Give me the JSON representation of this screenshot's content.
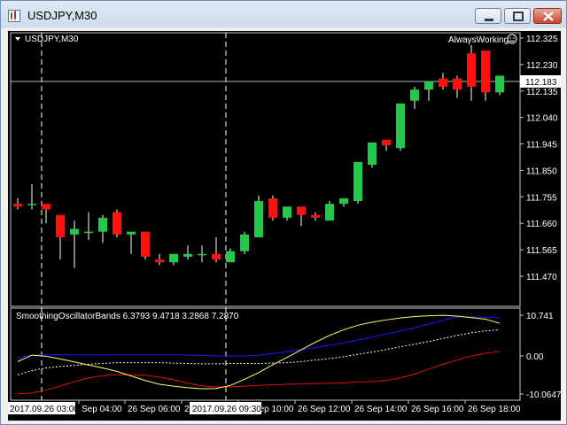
{
  "window": {
    "title": "USDJPY,M30"
  },
  "main_panel": {
    "label": "USDJPY,M30",
    "expert": "AlwaysWorking",
    "price_ticks": [
      "112.325",
      "112.230",
      "112.135",
      "112.040",
      "111.945",
      "111.850",
      "111.755",
      "111.660",
      "111.565",
      "111.470"
    ],
    "current_price": "112.183"
  },
  "indicator_panel": {
    "label": "SmoothingOscillatorBands 6.3793 9.4718 3.2868 7.2870",
    "ticks": [
      "10.741",
      "0.00",
      "-10.0647"
    ]
  },
  "time_axis": {
    "labels": [
      "Sep 04:00",
      "26 Sep 06:00",
      "26 Sep 08:00",
      "26 Sep 10:00",
      "26 Sep 12:00",
      "26 Sep 14:00",
      "26 Sep 16:00",
      "26 Sep 18:00"
    ],
    "crosshair_left": "2017.09.26 03:00",
    "crosshair_right": "2017.09.26 09:30"
  },
  "colors": {
    "bull": "#22c94a",
    "bear": "#ff1010",
    "upper_band": "#1a1aff",
    "lower_band": "#e01010",
    "oscillator": "#ffff66",
    "mid": "#ffffff"
  },
  "candles": [
    [
      111.73,
      111.75,
      111.71,
      111.72
    ],
    [
      111.73,
      111.8,
      111.71,
      111.73
    ],
    [
      111.73,
      111.73,
      111.66,
      111.71
    ],
    [
      111.69,
      111.69,
      111.53,
      111.61
    ],
    [
      111.62,
      111.67,
      111.5,
      111.64
    ],
    [
      111.63,
      111.7,
      111.6,
      111.63
    ],
    [
      111.63,
      111.69,
      111.59,
      111.68
    ],
    [
      111.7,
      111.71,
      111.61,
      111.62
    ],
    [
      111.62,
      111.63,
      111.55,
      111.63
    ],
    [
      111.63,
      111.63,
      111.53,
      111.54
    ],
    [
      111.53,
      111.55,
      111.51,
      111.52
    ],
    [
      111.52,
      111.55,
      111.51,
      111.55
    ],
    [
      111.54,
      111.58,
      111.53,
      111.55
    ],
    [
      111.55,
      111.58,
      111.52,
      111.55
    ],
    [
      111.55,
      111.61,
      111.52,
      111.53
    ],
    [
      111.52,
      111.57,
      111.52,
      111.56
    ],
    [
      111.56,
      111.63,
      111.55,
      111.62
    ],
    [
      111.61,
      111.76,
      111.61,
      111.74
    ],
    [
      111.75,
      111.76,
      111.67,
      111.68
    ],
    [
      111.68,
      111.72,
      111.67,
      111.72
    ],
    [
      111.72,
      111.72,
      111.65,
      111.69
    ],
    [
      111.69,
      111.7,
      111.67,
      111.68
    ],
    [
      111.67,
      111.74,
      111.67,
      111.73
    ],
    [
      111.73,
      111.74,
      111.72,
      111.75
    ],
    [
      111.74,
      111.88,
      111.73,
      111.88
    ],
    [
      111.87,
      111.93,
      111.86,
      111.95
    ],
    [
      111.96,
      111.96,
      111.92,
      111.94
    ],
    [
      111.93,
      112.09,
      111.92,
      112.09
    ],
    [
      112.1,
      112.15,
      112.07,
      112.14
    ],
    [
      112.14,
      112.17,
      112.1,
      112.17
    ],
    [
      112.18,
      112.2,
      112.14,
      112.15
    ],
    [
      112.18,
      112.19,
      112.11,
      112.14
    ],
    [
      112.27,
      112.3,
      112.1,
      112.15
    ],
    [
      112.28,
      112.28,
      112.1,
      112.13
    ],
    [
      112.13,
      112.19,
      112.12,
      112.19
    ]
  ],
  "indicator": {
    "range": [
      -10.0647,
      10.741
    ],
    "upper": [
      -0.5,
      0.2,
      0.3,
      0.3,
      0.3,
      0.3,
      0.3,
      0.3,
      0.3,
      0.3,
      0.3,
      0.3,
      0.2,
      0.1,
      0.0,
      0.0,
      0.0,
      0.2,
      0.6,
      1.1,
      1.6,
      2.2,
      2.8,
      3.5,
      4.2,
      5.0,
      5.8,
      6.6,
      7.4,
      8.4,
      9.4,
      10.3,
      10.3,
      10.2,
      10.0
    ],
    "oscillator": [
      -1.5,
      0.2,
      -0.1,
      -0.8,
      -1.6,
      -2.4,
      -3.2,
      -4.1,
      -5.3,
      -6.5,
      -7.5,
      -8.0,
      -8.4,
      -8.7,
      -8.6,
      -7.8,
      -6.2,
      -4.4,
      -2.3,
      -0.4,
      1.6,
      3.6,
      5.4,
      6.9,
      8.1,
      8.9,
      9.5,
      10.0,
      10.4,
      10.6,
      10.7,
      10.5,
      10.1,
      9.7,
      8.6
    ],
    "mid": [
      -5.0,
      -3.9,
      -3.2,
      -2.8,
      -2.5,
      -2.2,
      -2.0,
      -1.8,
      -1.8,
      -1.8,
      -1.8,
      -1.9,
      -2.0,
      -2.1,
      -2.1,
      -2.0,
      -2.0,
      -2.0,
      -1.9,
      -1.8,
      -1.5,
      -1.1,
      -0.7,
      -0.2,
      0.4,
      1.0,
      1.7,
      2.4,
      3.1,
      3.8,
      4.6,
      5.4,
      6.1,
      6.6,
      6.9
    ],
    "lower": [
      -10.0,
      -9.8,
      -9.0,
      -8.0,
      -6.8,
      -5.8,
      -5.2,
      -5.0,
      -5.0,
      -5.1,
      -5.6,
      -6.3,
      -7.2,
      -7.9,
      -8.2,
      -8.2,
      -8.0,
      -7.8,
      -7.6,
      -7.5,
      -7.4,
      -7.3,
      -7.2,
      -7.1,
      -6.9,
      -6.8,
      -6.5,
      -5.8,
      -4.8,
      -3.5,
      -2.2,
      -1.1,
      0.0,
      0.7,
      1.2
    ]
  }
}
